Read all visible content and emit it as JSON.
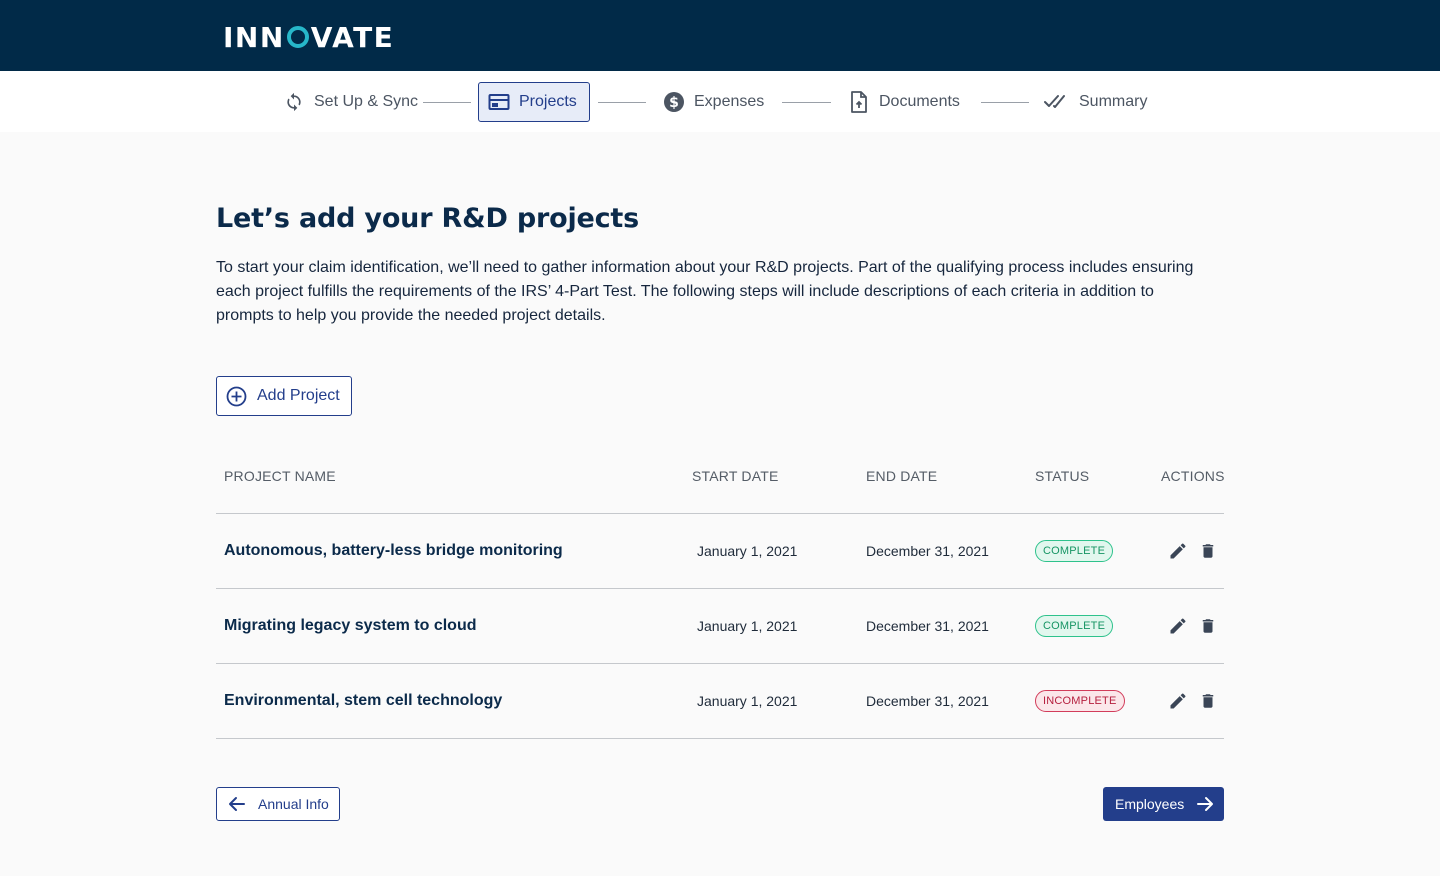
{
  "brand": {
    "pre": "INN",
    "post": "VATE"
  },
  "stepper": {
    "steps": [
      {
        "label": "Set Up & Sync",
        "icon": "sync-icon"
      },
      {
        "label": "Projects",
        "icon": "projects-icon"
      },
      {
        "label": "Expenses",
        "icon": "dollar-icon"
      },
      {
        "label": "Documents",
        "icon": "document-upload-icon"
      },
      {
        "label": "Summary",
        "icon": "double-check-icon"
      }
    ],
    "active_index": 1
  },
  "main": {
    "title": "Let’s add your R&D projects",
    "intro": "To start your claim identification, we’ll need to gather information about your R&D projects. Part of the qualifying process includes ensuring each project fulfills the requirements of the IRS’ 4-Part Test. The following steps will include descriptions of each criteria in addition to prompts to help you provide the needed project details.",
    "add_button": "Add Project"
  },
  "table": {
    "headers": [
      "PROJECT NAME",
      "START DATE",
      "END DATE",
      "STATUS",
      "ACTIONS"
    ],
    "rows": [
      {
        "name": "Autonomous, battery-less bridge monitoring",
        "start": "January 1, 2021",
        "end": "December 31, 2021",
        "status": "COMPLETE"
      },
      {
        "name": "Migrating legacy system to cloud",
        "start": "January 1, 2021",
        "end": "December 31, 2021",
        "status": "COMPLETE"
      },
      {
        "name": "Environmental, stem cell technology",
        "start": "January 1, 2021",
        "end": "December 31, 2021",
        "status": "INCOMPLETE"
      }
    ]
  },
  "footer": {
    "back_label": "Annual Info",
    "next_label": "Employees"
  },
  "colors": {
    "navbar": "#012a48",
    "primary": "#233e8b",
    "accent": "#27b7c9",
    "complete": "#2ec28c",
    "incomplete": "#d23c5a"
  }
}
